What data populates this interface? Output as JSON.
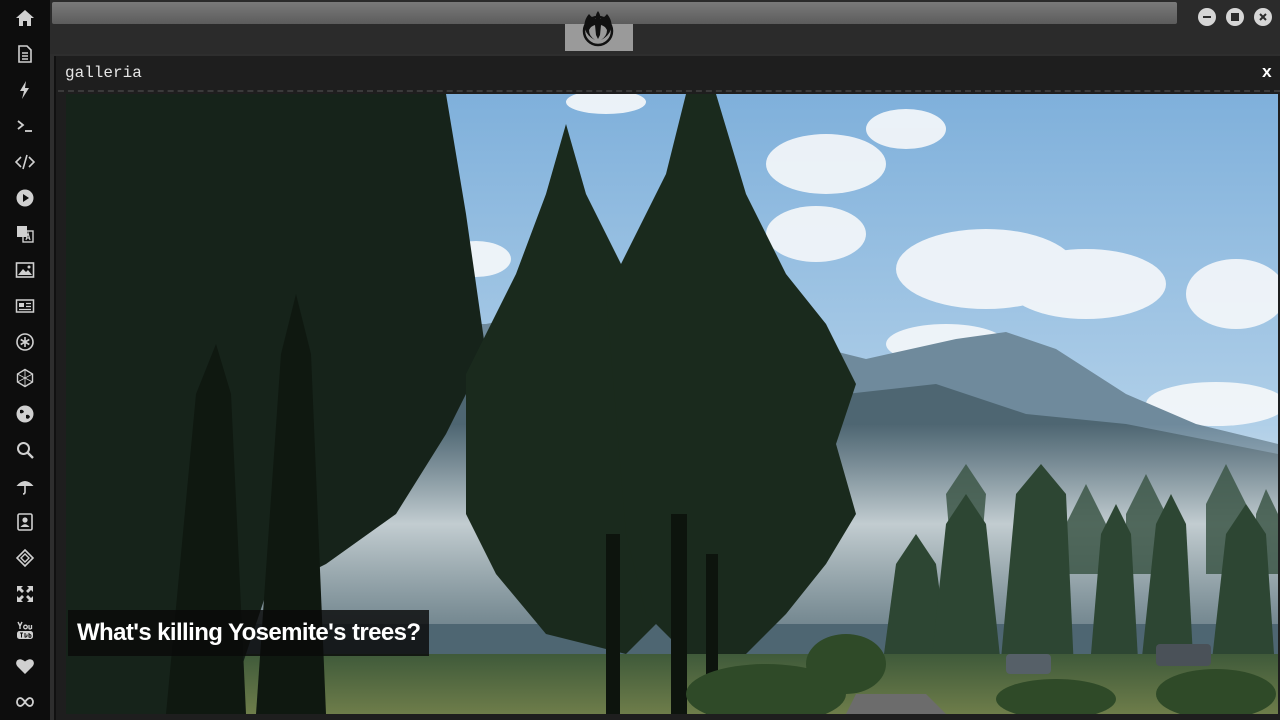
{
  "window": {
    "title": "galleria",
    "close_label": "x"
  },
  "gallery": {
    "caption": "What's killing Yosemite's trees?"
  },
  "sidebar": {
    "items": [
      {
        "icon": "home-icon"
      },
      {
        "icon": "document-icon"
      },
      {
        "icon": "lightning-icon"
      },
      {
        "icon": "terminal-icon"
      },
      {
        "icon": "code-icon"
      },
      {
        "icon": "play-icon"
      },
      {
        "icon": "translate-icon"
      },
      {
        "icon": "image-icon"
      },
      {
        "icon": "newspaper-icon"
      },
      {
        "icon": "asterisk-icon"
      },
      {
        "icon": "network-icon"
      },
      {
        "icon": "globe-icon"
      },
      {
        "icon": "search-icon"
      },
      {
        "icon": "umbrella-icon"
      },
      {
        "icon": "contact-card-icon"
      },
      {
        "icon": "codepen-icon"
      },
      {
        "icon": "expand-icon"
      },
      {
        "icon": "youtube-icon"
      },
      {
        "icon": "heart-icon"
      },
      {
        "icon": "infinity-icon"
      }
    ]
  },
  "topbar": {
    "emblem_icon": "rebel-alliance-icon",
    "controls": [
      "minimize-icon",
      "maximize-icon",
      "close-icon"
    ]
  },
  "colors": {
    "sidebar_bg": "#0d0d0d",
    "icon": "#d0d0d0",
    "window_bg": "#1e1e1e"
  }
}
